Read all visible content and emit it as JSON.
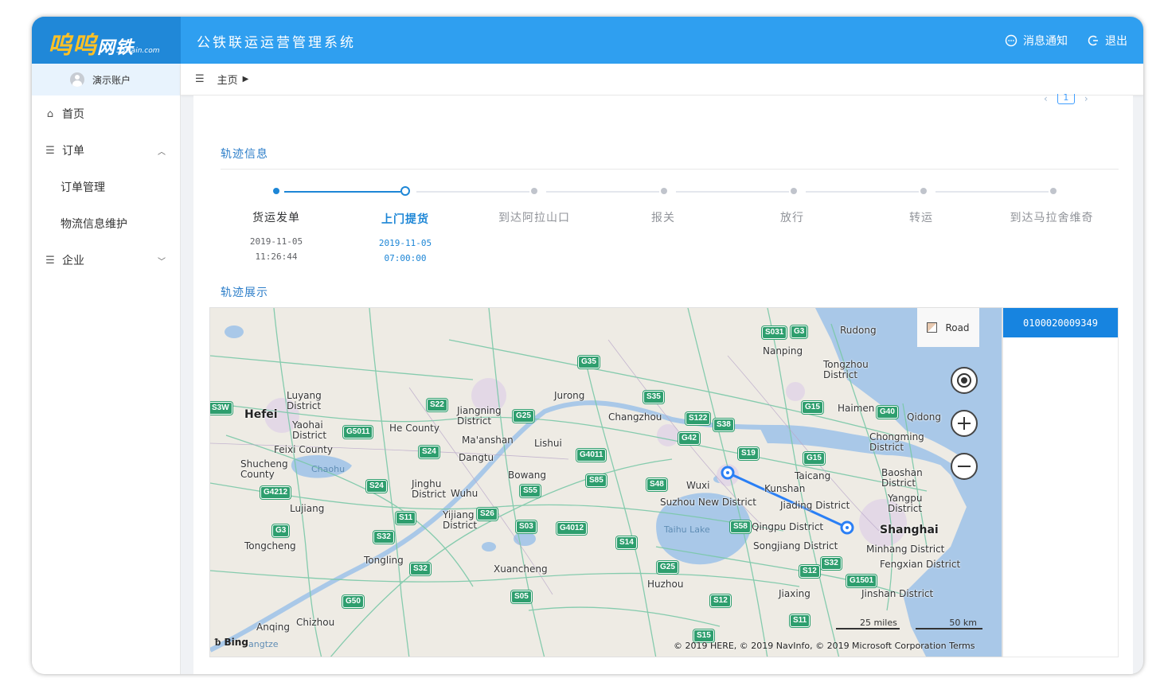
{
  "header": {
    "logo_main": "呜呜",
    "logo_net": "网铁",
    "logo_sub": "55train.com",
    "system_title": "公铁联运运营管理系统",
    "actions": [
      {
        "label": "消息通知",
        "icon": "message-icon"
      },
      {
        "label": "退出",
        "icon": "logout-icon"
      }
    ]
  },
  "sidebar": {
    "account": "演示账户",
    "items": [
      {
        "label": "首页",
        "icon": "home-icon"
      },
      {
        "label": "订单",
        "icon": "list-icon",
        "expanded": true
      },
      {
        "label": "订单管理"
      },
      {
        "label": "物流信息维护"
      },
      {
        "label": "企业",
        "icon": "list-icon",
        "expanded": false
      }
    ]
  },
  "breadcrumb": {
    "home": "主页"
  },
  "pager": {
    "current": "1"
  },
  "track": {
    "title": "轨迹信息",
    "steps": [
      {
        "label": "货运发单",
        "date": "2019-11-05",
        "time": "11:26:44",
        "state": "done"
      },
      {
        "label": "上门提货",
        "date": "2019-11-05",
        "time": "07:00:00",
        "state": "active"
      },
      {
        "label": "到达阿拉山口",
        "date": "",
        "time": "",
        "state": "pending"
      },
      {
        "label": "报关",
        "date": "",
        "time": "",
        "state": "pending"
      },
      {
        "label": "放行",
        "date": "",
        "time": "",
        "state": "pending"
      },
      {
        "label": "转运",
        "date": "",
        "time": "",
        "state": "pending"
      },
      {
        "label": "到达马拉舍维奇",
        "date": "",
        "time": "",
        "state": "pending"
      }
    ]
  },
  "map_section": {
    "title": "轨迹展示",
    "road_toggle": "Road",
    "scale_miles": "25 miles",
    "scale_km": "50 km",
    "copyright": "© 2019 HERE, © 2019 NavInfo, © 2019 Microsoft Corporation Terms",
    "bing": "Bing",
    "places": {
      "hefei": "Hefei",
      "luyang": "Luyang\nDistrict",
      "yaohai": "Yaohai\nDistrict",
      "feixi": "Feixi County",
      "shucheng": "Shucheng\nCounty",
      "chaohu": "Chaohu",
      "lujiang": "Lujiang",
      "tongcheng": "Tongcheng",
      "anqing": "Anqing",
      "chizhou": "Chizhou",
      "he_county": "He County",
      "jiangning": "Jiangning\nDistrict",
      "maanshan": "Ma'anshan",
      "dangtu": "Dangtu",
      "jinghu": "Jinghu\nDistrict",
      "wuhu": "Wuhu",
      "yijiang": "Yijiang\nDistrict",
      "tongling": "Tongling",
      "jurong": "Jurong",
      "lishui": "Lishui",
      "bowang": "Bowang",
      "xuancheng": "Xuancheng",
      "changzhou": "Changzhou",
      "wuxi": "Wuxi",
      "suzhou_new": "Suzhou New District",
      "taihu": "Taihu Lake",
      "huzhou": "Huzhou",
      "nanping": "Nanping",
      "rudong": "Rudong",
      "tongzhou": "Tongzhou\nDistrict",
      "haimen": "Haimen",
      "qidong": "Qidong",
      "chongming": "Chongming\nDistrict",
      "taicang": "Taicang",
      "kunshan": "Kunshan",
      "jiading": "Jiading District",
      "baoshan": "Baoshan\nDistrict",
      "yangpu": "Yangpu\nDistrict",
      "qingpu": "Qingpu District",
      "shanghai": "Shanghai",
      "songjiang": "Songjiang District",
      "minhang": "Minhang District",
      "fengxian": "Fengxian District",
      "jiaxing": "Jiaxing",
      "jinshan": "Jinshan District",
      "angtze": "angtze"
    },
    "shields": [
      "S031",
      "G3",
      "G35",
      "G15",
      "S35",
      "S122",
      "S38",
      "G42",
      "S19",
      "G40",
      "G15",
      "S22",
      "G25",
      "G5011",
      "S24",
      "S24",
      "G4212",
      "G3",
      "S32",
      "S11",
      "S26",
      "S55",
      "G4011",
      "S85",
      "S48",
      "S03",
      "G4012",
      "S14",
      "S58",
      "S32",
      "S12",
      "G1501",
      "G25",
      "S05",
      "G50",
      "S12",
      "S11",
      "S32",
      "S15",
      "S3W"
    ],
    "vehicles": [
      {
        "id": "01000200093 49",
        "display": "0100020009349"
      }
    ],
    "route_color": "#2a7ff5"
  }
}
